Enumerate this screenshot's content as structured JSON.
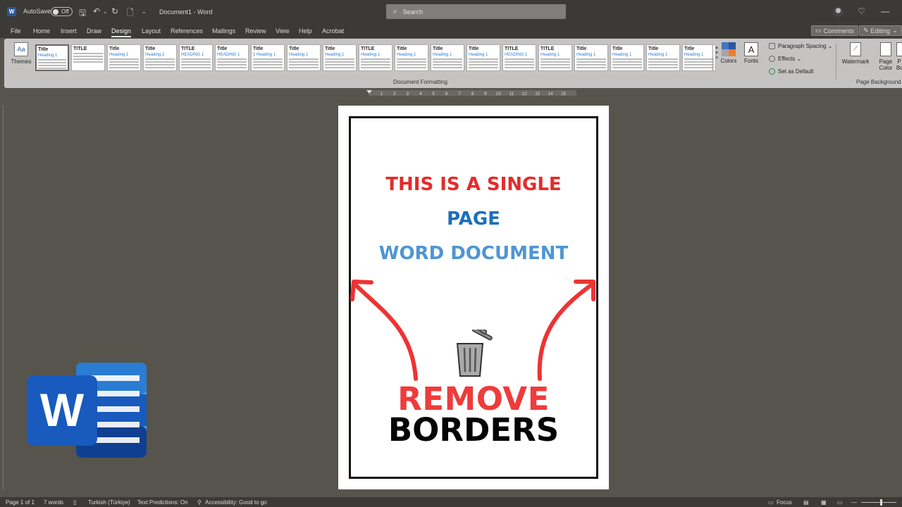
{
  "titlebar": {
    "app_icon": "W",
    "autosave_label": "AutoSave",
    "autosave_state": "Off",
    "document_title": "Document1  -  Word",
    "search_placeholder": "Search"
  },
  "menu": {
    "tabs": [
      "File",
      "Home",
      "Insert",
      "Draw",
      "Design",
      "Layout",
      "References",
      "Mailings",
      "Review",
      "View",
      "Help",
      "Acrobat"
    ],
    "active_tab": "Design",
    "comments_label": "Comments",
    "editing_label": "Editing"
  },
  "ribbon": {
    "themes_label": "Themes",
    "gallery": [
      {
        "title": "Title",
        "heading": "Heading 1"
      },
      {
        "title": "TITLE",
        "heading": ""
      },
      {
        "title": "Title",
        "heading": "Heading 1"
      },
      {
        "title": "Title",
        "heading": "Heading 1"
      },
      {
        "title": "TITLE",
        "heading": "HEADING 1"
      },
      {
        "title": "Title",
        "heading": "HEADING 1"
      },
      {
        "title": "Title",
        "heading": "1  Heading 1"
      },
      {
        "title": "Title",
        "heading": "Heading 1"
      },
      {
        "title": "Title",
        "heading": "Heading 1"
      },
      {
        "title": "TITLE",
        "heading": "Heading 1"
      },
      {
        "title": "Title",
        "heading": "Heading 1"
      },
      {
        "title": "Title",
        "heading": "Heading 1"
      },
      {
        "title": "Title",
        "heading": "Heading 1"
      },
      {
        "title": "TITLE",
        "heading": "HEADING 1"
      },
      {
        "title": "TITLE",
        "heading": "Heading 1"
      },
      {
        "title": "Title",
        "heading": "Heading 1"
      },
      {
        "title": "Title",
        "heading": "Heading 1"
      },
      {
        "title": "Title",
        "heading": "Heading 1"
      },
      {
        "title": "Title",
        "heading": "Heading 1"
      }
    ],
    "document_formatting_label": "Document Formatting",
    "colors_label": "Colors",
    "fonts_label": "Fonts",
    "paragraph_spacing_label": "Paragraph Spacing",
    "effects_label": "Effects",
    "set_default_label": "Set as Default",
    "watermark_label": "Watermark",
    "page_color_label": "Page Color",
    "page_borders_label": "P Bo",
    "page_background_label": "Page Background"
  },
  "ruler": {
    "marks": [
      "1",
      "2",
      "3",
      "4",
      "5",
      "6",
      "7",
      "8",
      "9",
      "10",
      "11",
      "12",
      "13",
      "14",
      "15"
    ]
  },
  "document": {
    "line1": "THIS IS A SINGLE",
    "line2": "PAGE",
    "line3": "WORD DOCUMENT",
    "remove": "REMOVE",
    "borders": "BORDERS"
  },
  "logo": {
    "letter": "W"
  },
  "status": {
    "page": "Page 1 of 1",
    "words": "7 words",
    "language": "Turkish (Türkiye)",
    "text_predictions": "Text Predictions: On",
    "accessibility": "Accessibility: Good to go",
    "focus": "Focus"
  },
  "colors": {
    "red": "#e62a2a",
    "blue": "#1e6eb9",
    "lightblue": "#4e96d2",
    "word_blue": "#2b579a"
  }
}
